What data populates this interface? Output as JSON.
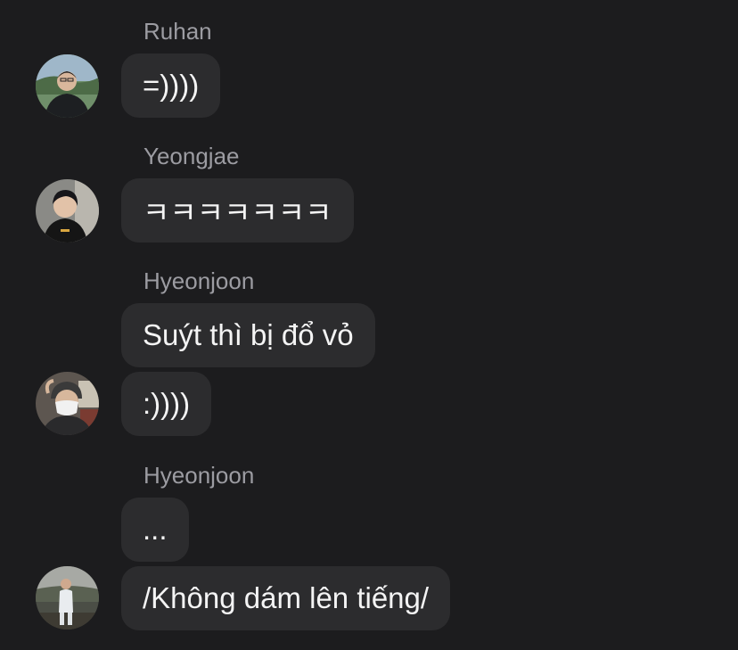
{
  "messages": [
    {
      "sender": "Ruhan",
      "texts": [
        "=))))"
      ]
    },
    {
      "sender": "Yeongjae",
      "texts": [
        "ㅋㅋㅋㅋㅋㅋㅋ"
      ]
    },
    {
      "sender": "Hyeonjoon",
      "texts": [
        "Suýt thì bị đổ vỏ",
        ":))))"
      ]
    },
    {
      "sender": "Hyeonjoon",
      "texts": [
        "...",
        "/Không dám lên tiếng/"
      ]
    }
  ],
  "colors": {
    "background": "#1c1c1e",
    "bubble": "#2c2c2e",
    "sender_name": "#9c9ca2",
    "message_text": "#f4f4f4"
  }
}
